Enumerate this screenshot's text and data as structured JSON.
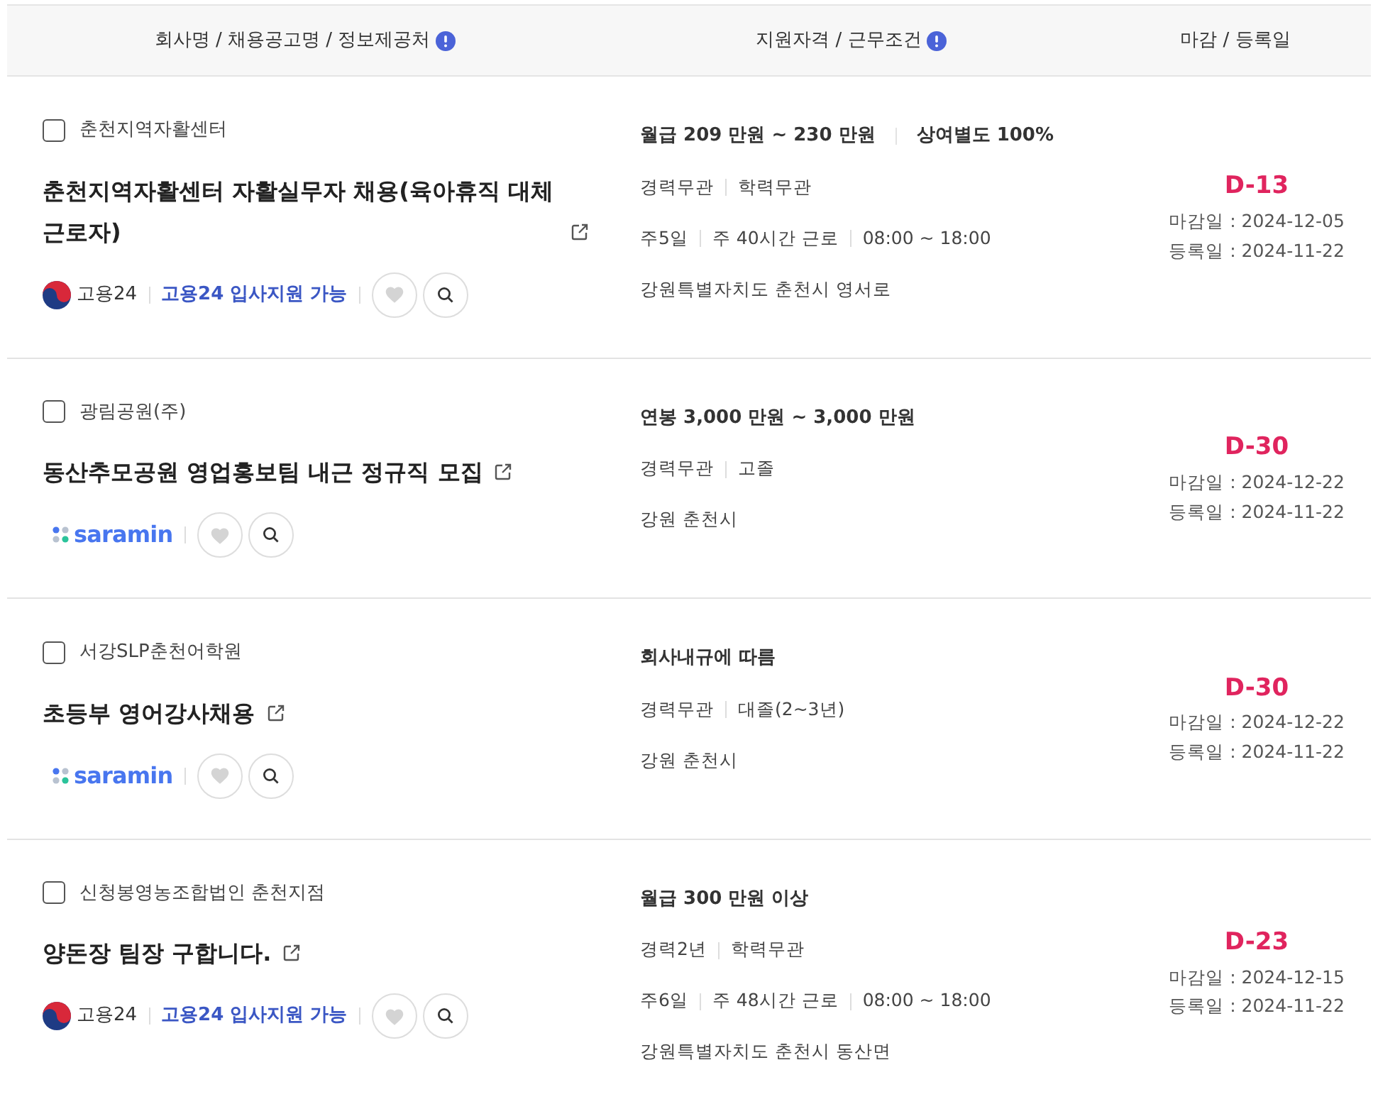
{
  "header": [
    {
      "label": "회사명 / 채용공고명 / 정보제공처",
      "info": true
    },
    {
      "label": "지원자격 / 근무조건",
      "info": true
    },
    {
      "label": "마감 / 등록일",
      "info": false
    }
  ],
  "rows": [
    {
      "company": "춘천지역자활센터",
      "checked": false,
      "title": "춘천지역자활센터 자활실무자 채용(육아휴직 대체 근로자)",
      "source": {
        "kind": "work24",
        "name": "고용24",
        "apply": "고용24 입사지원 가능"
      },
      "pay": [
        "월급 209 만원 ~ 230 만원",
        "상여별도 100%"
      ],
      "conditions": [
        [
          "경력무관",
          "학력무관"
        ],
        [
          "주5일",
          "주 40시간 근로",
          "08:00 ~ 18:00"
        ],
        [
          "강원특별자치도 춘천시 영서로"
        ]
      ],
      "dday": "D-13",
      "deadline": "마감일 : 2024-12-05",
      "registered": "등록일 : 2024-11-22"
    },
    {
      "company": "광림공원(주)",
      "checked": false,
      "title": "동산추모공원 영업홍보팀 내근 정규직 모집",
      "source": {
        "kind": "saramin",
        "name": "saramin"
      },
      "pay": [
        "연봉 3,000 만원 ~ 3,000 만원"
      ],
      "conditions": [
        [
          "경력무관",
          "고졸"
        ],
        [
          "강원 춘천시"
        ]
      ],
      "dday": "D-30",
      "deadline": "마감일 : 2024-12-22",
      "registered": "등록일 : 2024-11-22"
    },
    {
      "company": "서강SLP춘천어학원",
      "checked": false,
      "title": "초등부 영어강사채용",
      "source": {
        "kind": "saramin",
        "name": "saramin"
      },
      "pay": [
        "회사내규에 따름"
      ],
      "conditions": [
        [
          "경력무관",
          "대졸(2~3년)"
        ],
        [
          "강원 춘천시"
        ]
      ],
      "dday": "D-30",
      "deadline": "마감일 : 2024-12-22",
      "registered": "등록일 : 2024-11-22"
    },
    {
      "company": "신청봉영농조합법인 춘천지점",
      "checked": false,
      "title": "양돈장 팀장 구합니다.",
      "source": {
        "kind": "work24",
        "name": "고용24",
        "apply": "고용24 입사지원 가능"
      },
      "pay": [
        "월급 300 만원 이상"
      ],
      "conditions": [
        [
          "경력2년",
          "학력무관"
        ],
        [
          "주6일",
          "주 48시간 근로",
          "08:00 ~ 18:00"
        ],
        [
          "강원특별자치도 춘천시 동산면"
        ]
      ],
      "dday": "D-23",
      "deadline": "마감일 : 2024-12-15",
      "registered": "등록일 : 2024-11-22"
    }
  ]
}
